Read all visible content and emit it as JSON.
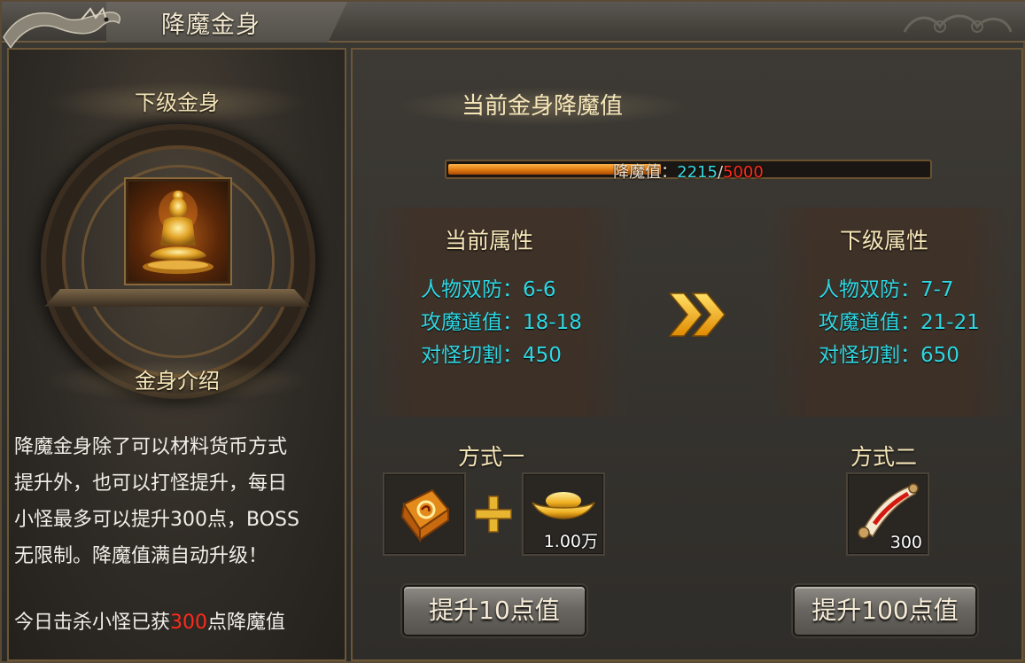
{
  "window": {
    "title": "降魔金身"
  },
  "left": {
    "next_body_header": "下级金身",
    "intro_header": "金身介绍",
    "description_lines": [
      "降魔金身除了可以材料货币方式",
      "提升外，也可以打怪提升，每日",
      "小怪最多可以提升300点，BOSS",
      "无限制。降魔值满自动升级！"
    ],
    "kill_prefix": "今日击杀小怪已获",
    "kill_value": "300",
    "kill_suffix": "点降魔值"
  },
  "progress": {
    "title": "当前金身降魔值",
    "label": "降魔值：",
    "current": "2215",
    "separator": "/",
    "max": "5000",
    "fraction": 0.443
  },
  "current_attrs": {
    "title": "当前属性",
    "rows": [
      "人物双防：6-6",
      "攻魔道值：18-18",
      "对怪切割：450"
    ]
  },
  "next_attrs": {
    "title": "下级属性",
    "rows": [
      "人物双防：7-7",
      "攻魔道值：21-21",
      "对怪切割：650"
    ]
  },
  "method_one": {
    "title": "方式一",
    "item1_icon": "rune-box-icon",
    "item2_icon": "gold-ingot-icon",
    "item2_count": "1.00万",
    "button": "提升10点值"
  },
  "method_two": {
    "title": "方式二",
    "item_icon": "scroll-icon",
    "item_count": "300",
    "button": "提升100点值"
  },
  "colors": {
    "accent_cyan": "#2fd7e3",
    "accent_red": "#ff2a1a",
    "header_gold": "#f6e6b8",
    "bar_orange": "#e07a10"
  }
}
